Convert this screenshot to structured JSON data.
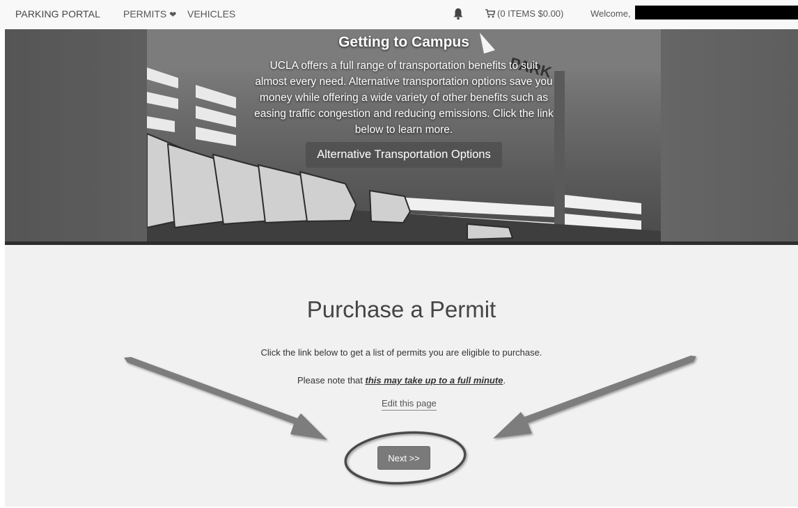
{
  "navbar": {
    "brand": "PARKING PORTAL",
    "permits_label": "PERMITS",
    "permits_icon": "chevron-down-icon",
    "vehicles_label": "VEHICLES",
    "bell_icon": "bell-icon",
    "cart_icon": "cart-icon",
    "cart_label": "(0 ITEMS $0.00)",
    "welcome_label": "Welcome,"
  },
  "hero": {
    "title": "Getting to Campus",
    "body": "UCLA offers a full range of transportation benefits to suit almost every need. Alternative transportation options save you money while offering a wide variety of other benefits such as easing traffic congestion and reducing emissions. Click the link below to learn more.",
    "button_label": "Alternative Transportation Options",
    "sign_text": "PARK"
  },
  "main": {
    "title": "Purchase a Permit",
    "description": "Click the link below to get a list of permits you are eligible to purchase.",
    "note_prefix": "Please note that ",
    "note_emphasis": "this may take up to a full minute",
    "note_suffix": ".",
    "edit_link": "Edit this page",
    "next_label": "Next >>"
  },
  "colors": {
    "navbar_bg": "#f8f8f8",
    "main_bg": "#f1f1f1",
    "next_button": "#7a7a7a",
    "annotation": "#7d7d7d"
  }
}
